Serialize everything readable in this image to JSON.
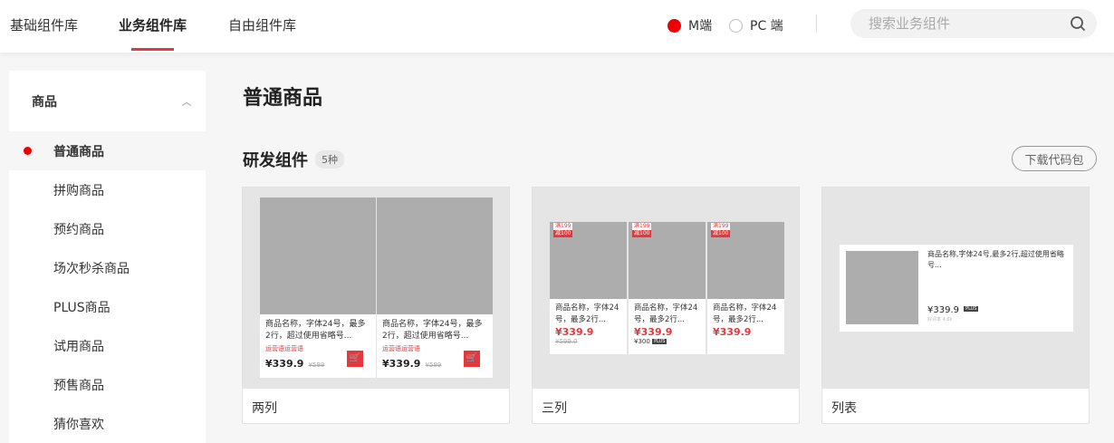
{
  "header": {
    "tabs": [
      {
        "label": "基础组件库",
        "active": false
      },
      {
        "label": "业务组件库",
        "active": true
      },
      {
        "label": "自由组件库",
        "active": false
      }
    ],
    "platforms": [
      {
        "label": "M端",
        "selected": true
      },
      {
        "label": "PC 端",
        "selected": false
      }
    ],
    "search_placeholder": "搜索业务组件",
    "search_icon": "search-icon"
  },
  "sidebar": {
    "group": "商品",
    "items": [
      "普通商品",
      "拼购商品",
      "预约商品",
      "场次秒杀商品",
      "PLUS商品",
      "试用商品",
      "预售商品",
      "猜你喜欢"
    ],
    "active": "普通商品"
  },
  "main": {
    "title": "普通商品",
    "section": "研发组件",
    "count": "5种",
    "download": "下载代码包",
    "cards": [
      {
        "label": "两列",
        "product": {
          "name": "商品名称，字体24号，最多2行，超过使用省略号...",
          "promo": "运营语运营语",
          "price": "¥339.9",
          "orig": "¥599"
        }
      },
      {
        "label": "三列",
        "product": {
          "name": "商品名称，字体24号，最多2行...",
          "tag1": "满199",
          "tag2": "减100",
          "price": "¥339.9",
          "orig": "¥599.0",
          "plus_price": "¥300",
          "plus_tag": "PLUS"
        }
      },
      {
        "label": "列表",
        "product": {
          "name": "商品名称,字体24号,最多2行,超过使用省略号...",
          "price": "¥339.9",
          "tag": "PLUS",
          "sub": "好评率 4.6k"
        }
      }
    ]
  },
  "colors": {
    "accent": "#e4393c",
    "active_dot": "#ee0000"
  }
}
